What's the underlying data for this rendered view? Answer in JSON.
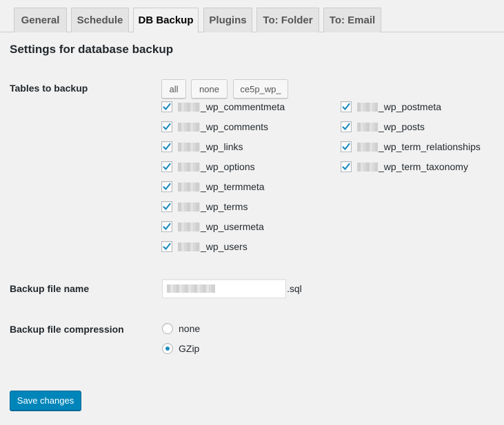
{
  "tabs": [
    {
      "label": "General"
    },
    {
      "label": "Schedule"
    },
    {
      "label": "DB Backup",
      "active": true
    },
    {
      "label": "Plugins"
    },
    {
      "label": "To: Folder"
    },
    {
      "label": "To: Email"
    }
  ],
  "section_title": "Settings for database backup",
  "tables": {
    "label": "Tables to backup",
    "buttons": {
      "all": "all",
      "none": "none",
      "prefix": "ce5p_wp_"
    },
    "left": [
      "_wp_commentmeta",
      "_wp_comments",
      "_wp_links",
      "_wp_options",
      "_wp_termmeta",
      "_wp_terms",
      "_wp_usermeta",
      "_wp_users"
    ],
    "right": [
      "_wp_postmeta",
      "_wp_posts",
      "_wp_term_relationships",
      "_wp_term_taxonomy"
    ]
  },
  "file_name": {
    "label": "Backup file name",
    "suffix": ".sql"
  },
  "compression": {
    "label": "Backup file compression",
    "options": [
      "none",
      "GZip"
    ],
    "selected": "GZip"
  },
  "save_label": "Save changes",
  "colors": {
    "primary": "#0085ba",
    "checkmark": "#1e8cbe"
  }
}
